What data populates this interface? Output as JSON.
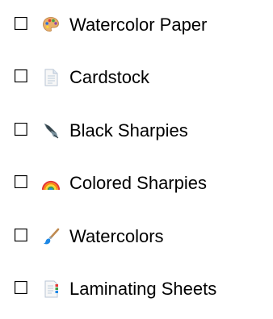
{
  "checklist": {
    "items": [
      {
        "checkbox": "☐",
        "icon": "artist-palette-icon",
        "label": "Watercolor Paper"
      },
      {
        "checkbox": "☐",
        "icon": "page-facing-up-icon",
        "label": "Cardstock"
      },
      {
        "checkbox": "☐",
        "icon": "fountain-pen-icon",
        "label": "Black Sharpies"
      },
      {
        "checkbox": "☐",
        "icon": "rainbow-icon",
        "label": "Colored Sharpies"
      },
      {
        "checkbox": "☐",
        "icon": "paintbrush-icon",
        "label": "Watercolors"
      },
      {
        "checkbox": "☐",
        "icon": "bookmark-tabs-icon",
        "label": "Laminating Sheets"
      }
    ]
  }
}
